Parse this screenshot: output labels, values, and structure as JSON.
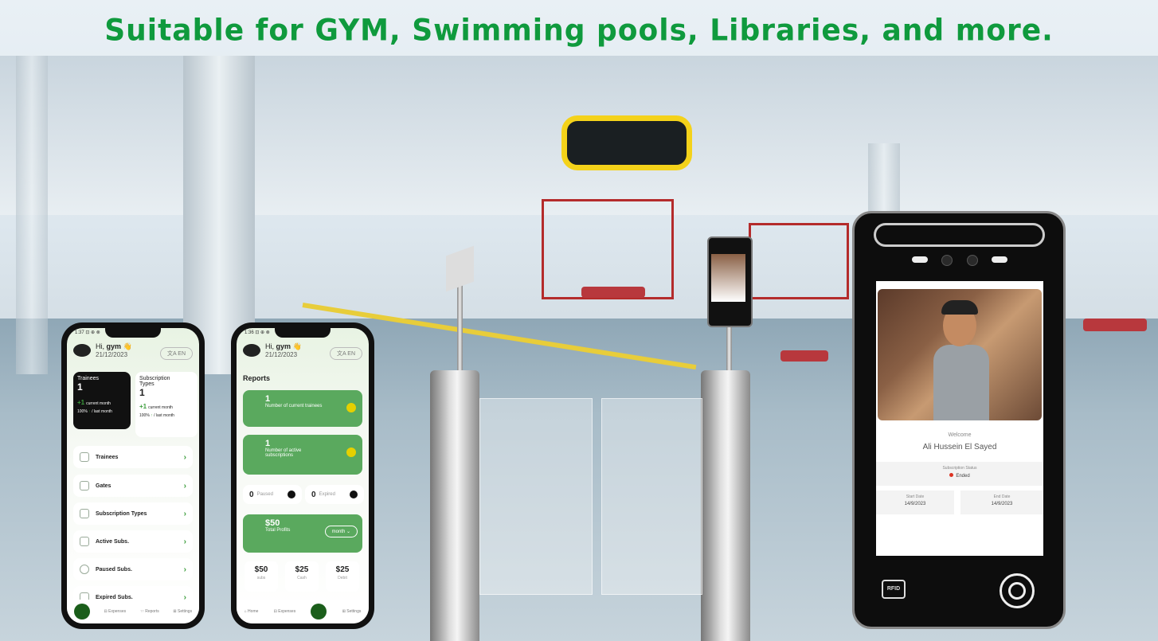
{
  "headline": "Suitable for GYM, Swimming pools, Libraries, and more.",
  "phone1": {
    "status": "1:37 ⊡ ⊕ ⊗",
    "greeting_hi": "Hi,",
    "greeting_name": "gym",
    "date": "21/12/2023",
    "lang": "文A EN",
    "trainees": {
      "label": "Trainees",
      "value": "1",
      "delta": "+1",
      "delta_label": "current month",
      "pct": "100%",
      "pct_label": "/ last month"
    },
    "subscription_types": {
      "label_1": "Subscription",
      "label_2": "Types",
      "value": "1",
      "delta": "+1",
      "delta_label": "current month",
      "pct": "100%",
      "pct_label": "/ last month"
    },
    "menu": [
      {
        "label": "Trainees"
      },
      {
        "label": "Gates"
      },
      {
        "label": "Subscription Types"
      },
      {
        "label": "Active Subs."
      },
      {
        "label": "Paused Subs."
      },
      {
        "label": "Expired Subs."
      }
    ],
    "bottom": {
      "expenses": "Expenses",
      "reports": "Reports",
      "settings": "Settings"
    }
  },
  "phone2": {
    "status": "1:36 ⊡ ⊕ ⊗",
    "greeting_hi": "Hi,",
    "greeting_name": "gym",
    "date": "21/12/2023",
    "lang": "文A EN",
    "title": "Reports",
    "trainees_card": {
      "value": "1",
      "label": "Number of current trainees"
    },
    "subs_card": {
      "value": "1",
      "label_1": "Number of active",
      "label_2": "subscriptions"
    },
    "paused": {
      "value": "0",
      "label": "Paused"
    },
    "expired": {
      "value": "0",
      "label": "Expired"
    },
    "profits": {
      "value": "$50",
      "label": "Total Profits",
      "period": "month ⌄"
    },
    "cells": [
      {
        "value": "$50",
        "label": "subs"
      },
      {
        "value": "$25",
        "label": "Cash"
      },
      {
        "value": "$25",
        "label": "Debit"
      }
    ],
    "bottom": {
      "home": "Home",
      "expenses": "Expenses",
      "settings": "Settings"
    }
  },
  "terminal": {
    "welcome": "Welcome",
    "name": "Ali Hussein El Sayed",
    "status_label": "Subscription Status",
    "status_value": "Ended",
    "start_label": "Start Date",
    "start_value": "14/9/2023",
    "end_label": "End Date",
    "end_value": "14/9/2023",
    "rfid": "RFID"
  },
  "colors": {
    "headline": "#0f9a3d",
    "accent_green": "#5aa95e",
    "status_red": "#dd3322"
  }
}
